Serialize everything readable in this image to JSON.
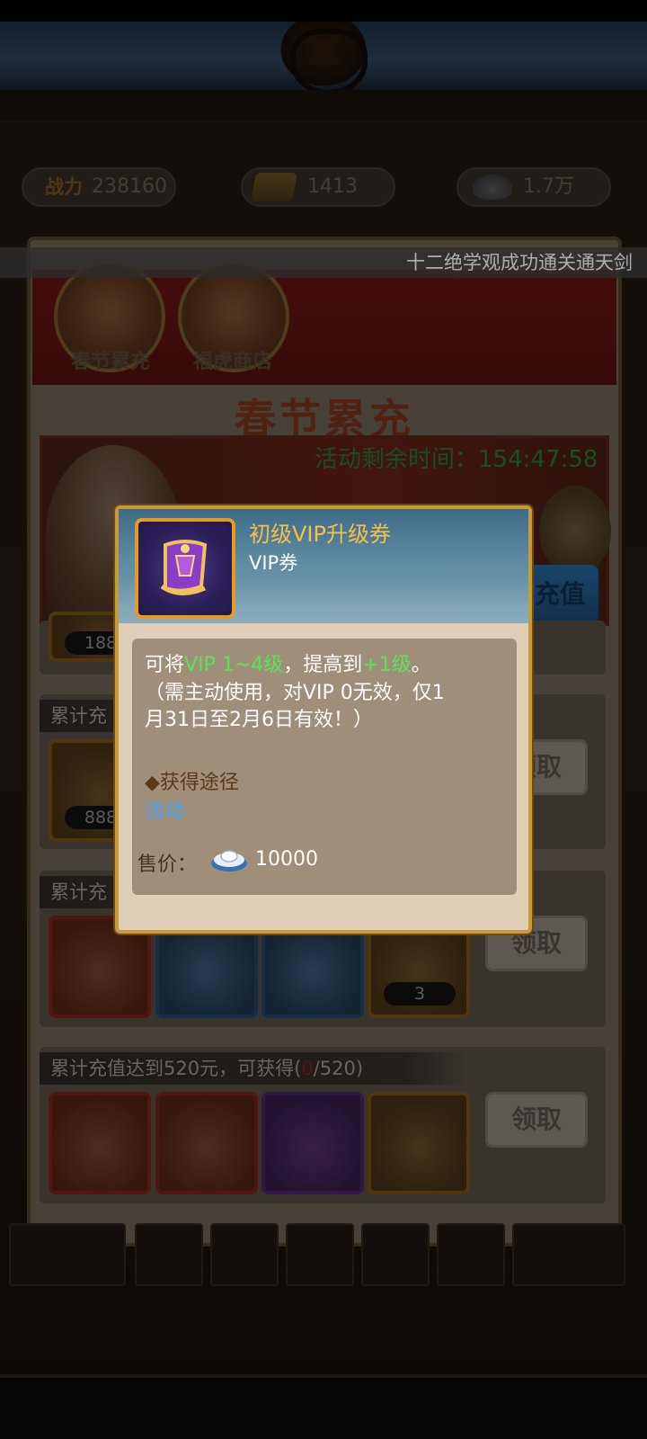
{
  "header": {
    "power_label": "战力",
    "power_value": "238160",
    "gold_value": "1413",
    "silver_value": "1.7万"
  },
  "marquee": {
    "text": "十二绝学观成功通关通天剑"
  },
  "activity": {
    "tabs": [
      {
        "label": "春节累充"
      },
      {
        "label": "福虎商店"
      }
    ],
    "title": "春节累充",
    "banner": {
      "countdown": "活动剩余时间：154:47:58",
      "recharge_label": "充值"
    },
    "rows": [
      {
        "title": "",
        "counts": [
          "188"
        ],
        "claim_label": ""
      },
      {
        "title": "累计充",
        "counts": [
          "888"
        ],
        "claim_label": "领取"
      },
      {
        "title": "累计充",
        "counts": [
          "3"
        ],
        "claim_label": "领取"
      },
      {
        "title_prefix": "累计充值达到520元，可获得(",
        "progress": "0",
        "title_suffix": "/520)",
        "claim_label": "领取"
      }
    ]
  },
  "tooltip": {
    "item_name": "初级VIP升级券",
    "item_type": "VIP券",
    "desc": {
      "p1_a": "可将",
      "p1_b": "VIP 1~4级",
      "p1_c": "，提高到",
      "p1_d": "+1级",
      "p1_e": "。",
      "line2": "（需主动使用，对VIP 0无效，仅1",
      "line3": "月31日至2月6日有效！）"
    },
    "source_heading": "◆获得途径",
    "source_link": "活动",
    "price_label": "售价：",
    "price_value": "10000"
  },
  "colors": {
    "item_name": "#f3c04a",
    "highlight_green": "#5ce05a",
    "link_blue": "#3ea6ff",
    "popup_border": "#c79a3a"
  },
  "icons": [
    "gold-ingot-icon",
    "silver-ingot-icon",
    "vip-scroll-icon",
    "treasure-chest-icon",
    "gem-pile-icon",
    "gift-box-icon"
  ]
}
